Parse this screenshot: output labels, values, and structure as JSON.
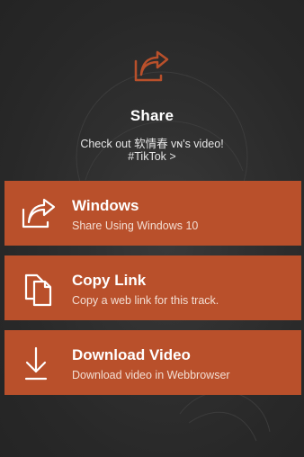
{
  "header": {
    "title": "Share",
    "subtitle": "Check out 软情春 ᴠɴ's video!",
    "tag_link": "#TikTok >"
  },
  "options": [
    {
      "title": "Windows",
      "description": "Share Using Windows 10",
      "icon": "share-icon"
    },
    {
      "title": "Copy Link",
      "description": "Copy a web link for this track.",
      "icon": "copy-icon"
    },
    {
      "title": "Download Video",
      "description": "Download video in Webbrowser",
      "icon": "download-icon"
    }
  ],
  "colors": {
    "accent": "#b9502b",
    "background": "#2b2b2b"
  }
}
